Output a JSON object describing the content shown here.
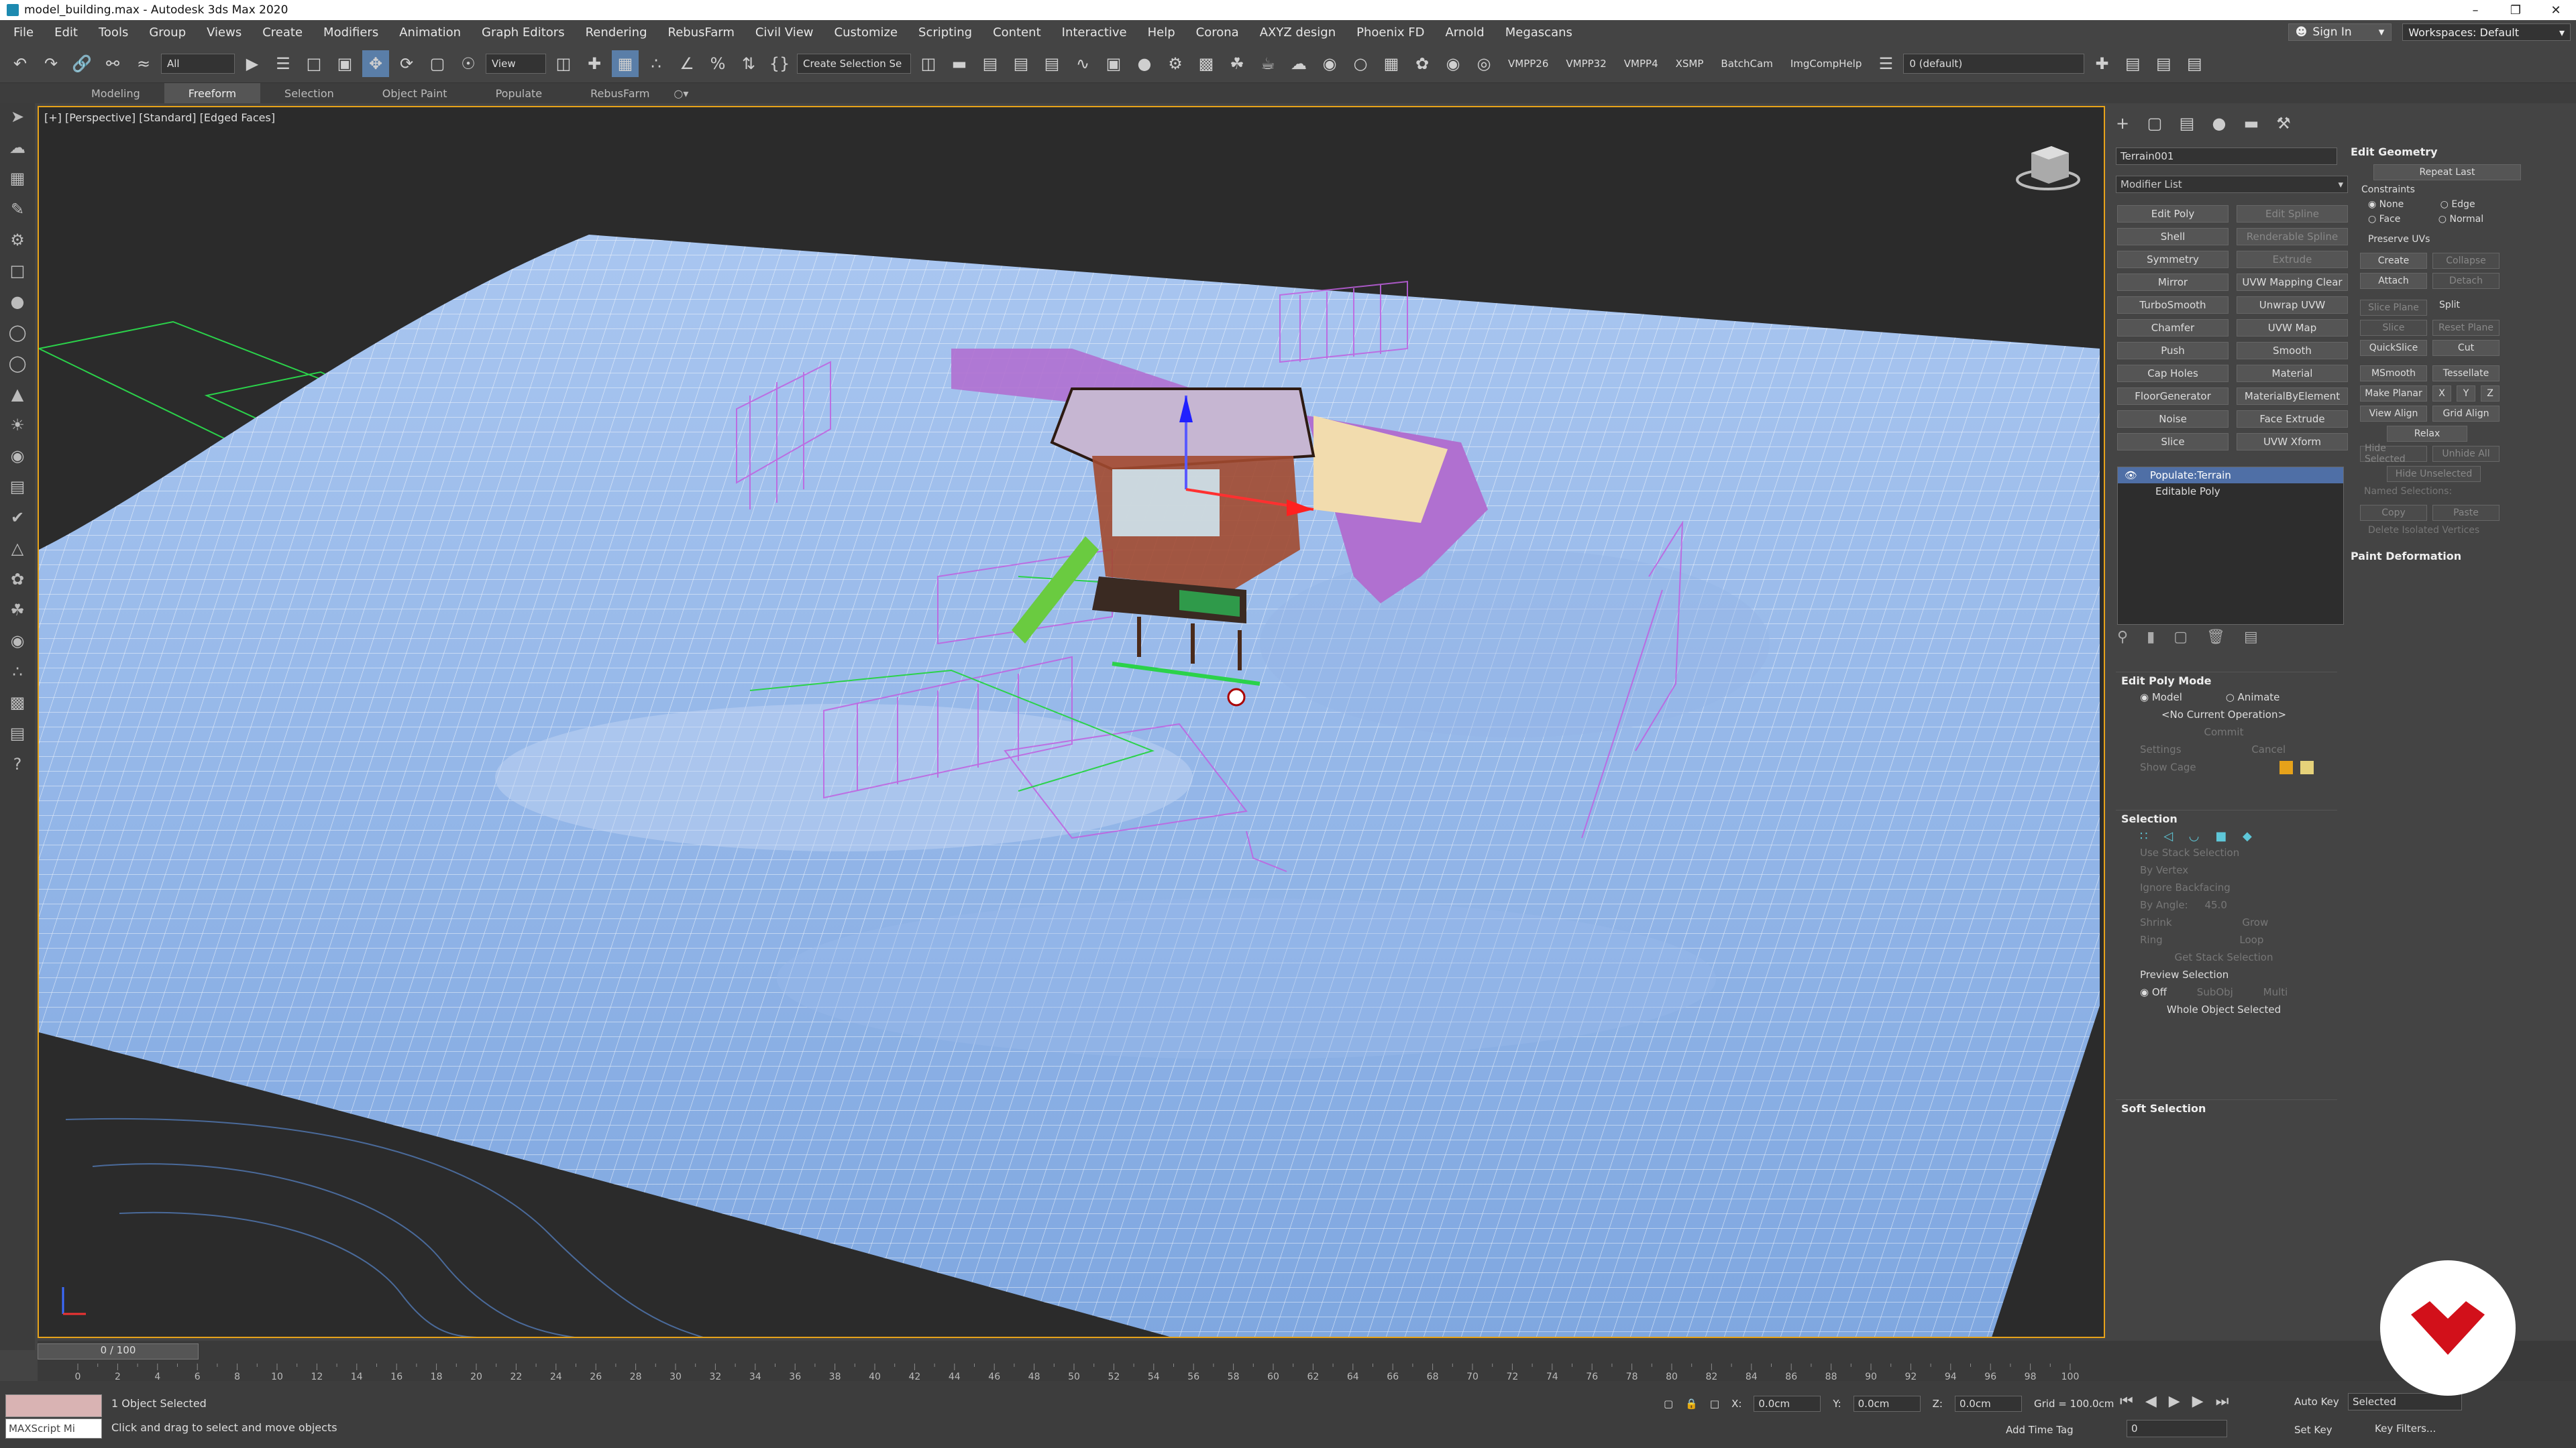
{
  "window": {
    "title": "model_building.max - Autodesk 3ds Max 2020",
    "controls": [
      "–",
      "❐",
      "✕"
    ]
  },
  "menu": [
    "File",
    "Edit",
    "Tools",
    "Group",
    "Views",
    "Create",
    "Modifiers",
    "Animation",
    "Graph Editors",
    "Rendering",
    "RebusFarm",
    "Civil View",
    "Customize",
    "Scripting",
    "Content",
    "Interactive",
    "Help",
    "Corona",
    "AXYZ design",
    "Phoenix FD",
    "Arnold",
    "Megascans"
  ],
  "account": {
    "signin": "Sign In",
    "workspace_label": "Workspaces: Default"
  },
  "toolbar": {
    "filter": "All",
    "ref_coord": "View",
    "selection_set": "Create Selection Se",
    "layer": "0 (default)",
    "scripts": [
      "VMPP26",
      "VMPP32",
      "VMPP4",
      "XSMP",
      "BatchCam",
      "ImgCompHelp"
    ]
  },
  "ribbon_tabs": [
    "Modeling",
    "Freeform",
    "Selection",
    "Object Paint",
    "Populate",
    "RebusFarm"
  ],
  "viewport": {
    "label": "[+] [Perspective] [Standard] [Edged Faces]"
  },
  "panel": {
    "object_name": "Terrain001",
    "object_color": "#6aaaff",
    "modifier_list": "Modifier List",
    "modifier_buttons": [
      {
        "l": "Edit Poly",
        "dim": false
      },
      {
        "l": "Edit Spline",
        "dim": true
      },
      {
        "l": "Shell",
        "dim": false
      },
      {
        "l": "Renderable Spline",
        "dim": true
      },
      {
        "l": "Symmetry",
        "dim": false
      },
      {
        "l": "Extrude",
        "dim": true
      },
      {
        "l": "Mirror",
        "dim": false
      },
      {
        "l": "UVW Mapping Clear",
        "dim": false
      },
      {
        "l": "TurboSmooth",
        "dim": false
      },
      {
        "l": "Unwrap UVW",
        "dim": false
      },
      {
        "l": "Chamfer",
        "dim": false
      },
      {
        "l": "UVW Map",
        "dim": false
      },
      {
        "l": "Push",
        "dim": false
      },
      {
        "l": "Smooth",
        "dim": false
      },
      {
        "l": "Cap Holes",
        "dim": false
      },
      {
        "l": "Material",
        "dim": false
      },
      {
        "l": "FloorGenerator",
        "dim": false
      },
      {
        "l": "MaterialByElement",
        "dim": false
      },
      {
        "l": "Noise",
        "dim": false
      },
      {
        "l": "Face Extrude",
        "dim": false
      },
      {
        "l": "Slice",
        "dim": false
      },
      {
        "l": "UVW Xform",
        "dim": false
      }
    ],
    "stack": [
      "Populate:Terrain",
      "Editable Poly"
    ],
    "edit_poly_mode": {
      "title": "Edit Poly Mode",
      "model": "Model",
      "animate": "Animate",
      "current_op": "<No Current Operation>",
      "commit": "Commit",
      "settings": "Settings",
      "cancel": "Cancel",
      "show_cage": "Show Cage"
    },
    "selection": {
      "title": "Selection",
      "use_stack": "Use Stack Selection",
      "by_vertex": "By Vertex",
      "ignore_backfacing": "Ignore Backfacing",
      "by_angle": "By Angle:",
      "angle_value": "45.0",
      "shrink": "Shrink",
      "grow": "Grow",
      "ring": "Ring",
      "loop": "Loop",
      "get_stack": "Get Stack Selection",
      "preview": "Preview Selection",
      "off": "Off",
      "subobj": "SubObj",
      "multi": "Multi",
      "whole": "Whole Object Selected"
    },
    "soft_selection": "Soft Selection",
    "edit_geometry": {
      "title": "Edit Geometry",
      "repeat_last": "Repeat Last",
      "constraints": "Constraints",
      "none": "None",
      "edge": "Edge",
      "face": "Face",
      "normal": "Normal",
      "preserve_uvs": "Preserve UVs",
      "create": "Create",
      "collapse": "Collapse",
      "attach": "Attach",
      "detach": "Detach",
      "slice_plane": "Slice Plane",
      "split": "Split",
      "slice": "Slice",
      "reset_plane": "Reset Plane",
      "quickslice": "QuickSlice",
      "cut": "Cut",
      "msmooth": "MSmooth",
      "tessellate": "Tessellate",
      "make_planar": "Make Planar",
      "x": "X",
      "y": "Y",
      "z": "Z",
      "view_align": "View Align",
      "grid_align": "Grid Align",
      "relax": "Relax",
      "hide_selected": "Hide Selected",
      "unhide_all": "Unhide All",
      "hide_unselected": "Hide Unselected",
      "named_sel": "Named Selections:",
      "copy": "Copy",
      "paste": "Paste",
      "delete_isolated": "Delete Isolated Vertices"
    },
    "paint_deformation": "Paint Deformation"
  },
  "timeline": {
    "slider": "0 / 100",
    "ticks": [
      "0",
      "2",
      "4",
      "6",
      "8",
      "10",
      "12",
      "14",
      "16",
      "18",
      "20",
      "22",
      "24",
      "26",
      "28",
      "30",
      "32",
      "34",
      "36",
      "38",
      "40",
      "42",
      "44",
      "46",
      "48",
      "50",
      "52",
      "54",
      "56",
      "58",
      "60",
      "62",
      "64",
      "66",
      "68",
      "70",
      "72",
      "74",
      "76",
      "78",
      "80",
      "82",
      "84",
      "86",
      "88",
      "90",
      "92",
      "94",
      "96",
      "98",
      "100"
    ]
  },
  "status": {
    "script": "MAXScript Mi",
    "selected": "1 Object Selected",
    "hint": "Click and drag to select and move objects",
    "x_label": "X:",
    "x_value": "0.0cm",
    "y_label": "Y:",
    "y_value": "0.0cm",
    "z_label": "Z:",
    "z_value": "0.0cm",
    "grid": "Grid = 100.0cm",
    "add_time_tag": "Add Time Tag",
    "auto_key": "Auto Key",
    "set_key": "Set Key",
    "selected_dd": "Selected",
    "key_filters": "Key Filters...",
    "frame": "0"
  }
}
